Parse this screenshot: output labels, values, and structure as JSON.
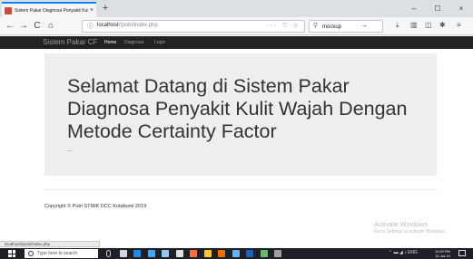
{
  "browser": {
    "tab_title": "Sistem Pakar Diagnosa Penyakit Kulit Wajah",
    "tab_close": "×",
    "new_tab": "+",
    "window": {
      "minimize": "–",
      "maximize": "☐",
      "close": "×"
    },
    "nav": {
      "back": "←",
      "forward": "→",
      "reload": "C",
      "home": "⌂"
    },
    "url_host": "localhost",
    "url_path": "/rputri/index.php",
    "url_actions": "··· ♡ ☆",
    "search_value": "mockup",
    "search_go": "→",
    "toolbar_icons": [
      "download-icon",
      "library-icon",
      "sidebar-icon",
      "extension-icon",
      "menu-icon"
    ],
    "status_url": "localhost/rputri/index.php"
  },
  "site": {
    "brand": "Sistem Pakar CF",
    "nav": [
      "Home",
      "Diagnosa",
      "Login"
    ],
    "active_nav": "Home",
    "headline": "Selamat Datang di Sistem Pakar Diagnosa Penyakit Kulit Wajah Dengan Metode Certainty Factor",
    "ellipsis": "...",
    "footer": "Copyright © Putri STMIK DCC Kotabumi 2019"
  },
  "watermark": {
    "line1": "Activate Windows",
    "line2": "Go to Settings to activate Windows."
  },
  "taskbar": {
    "search_placeholder": "Type here to search",
    "apps": [
      {
        "name": "mic-icon",
        "color": "#1f2027"
      },
      {
        "name": "task-view-icon",
        "color": "#cfd8dc"
      },
      {
        "name": "edge-icon",
        "color": "#1e88e5"
      },
      {
        "name": "store-icon",
        "color": "#42a5f5"
      },
      {
        "name": "shop-bag-icon",
        "color": "#90caf9"
      },
      {
        "name": "mail-icon",
        "color": "#e0e0e0"
      },
      {
        "name": "firefox-icon",
        "color": "#ff7043"
      },
      {
        "name": "files-icon",
        "color": "#ffca28"
      },
      {
        "name": "xampp-icon",
        "color": "#ef6c00"
      },
      {
        "name": "app-blue-icon",
        "color": "#64b5f6"
      },
      {
        "name": "photos-icon",
        "color": "#1565c0"
      },
      {
        "name": "chrome-icon",
        "color": "#66bb6a"
      },
      {
        "name": "app-grey-icon",
        "color": "#9e9e9e"
      }
    ],
    "tray": "⌃ ▬ ◢ ♪ ENG",
    "time": "11:09 PM",
    "date": "12-Jul-19"
  }
}
